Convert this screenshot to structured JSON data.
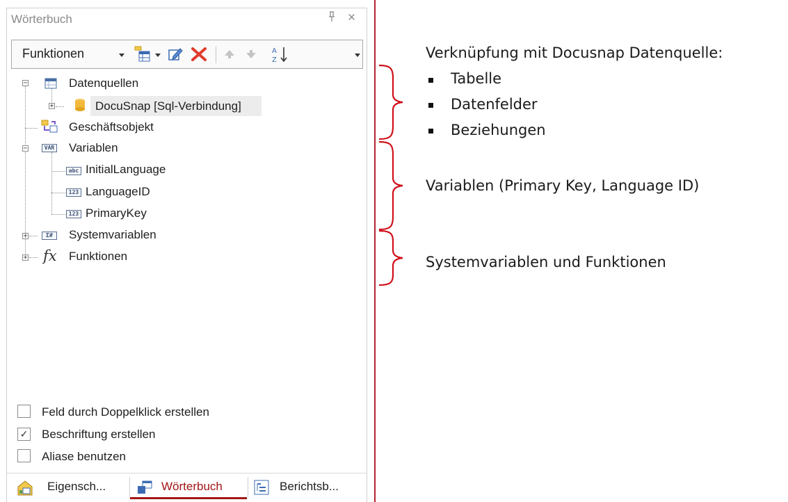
{
  "panel": {
    "title": "Wörterbuch",
    "pin_icon": "pin-icon",
    "close_icon": "close-icon"
  },
  "toolbar": {
    "functions_label": "Funktionen",
    "icons": [
      "new-item-icon",
      "edit-icon",
      "delete-icon",
      "move-up-icon",
      "move-down-icon",
      "sort-icon"
    ]
  },
  "tree": {
    "datasources": "Datenquellen",
    "docusnap": "DocuSnap [Sql-Verbindung]",
    "business_object": "Geschäftsobjekt",
    "variables": "Variablen",
    "var_items": [
      "InitialLanguage",
      "LanguageID",
      "PrimaryKey"
    ],
    "var_tags": [
      "abc",
      "123",
      "123"
    ],
    "variables_tag": "VAR",
    "systemvars": "Systemvariablen",
    "systemvars_tag": "Σ#",
    "functions": "Funktionen",
    "functions_symbol": "fx"
  },
  "options": [
    {
      "label": "Feld durch Doppelklick erstellen",
      "checked": false
    },
    {
      "label": "Beschriftung erstellen",
      "checked": true
    },
    {
      "label": "Aliase benutzen",
      "checked": false
    }
  ],
  "tabs": [
    {
      "label": "Eigensch...",
      "active": false
    },
    {
      "label": "Wörterbuch",
      "active": true
    },
    {
      "label": "Berichtsb...",
      "active": false
    }
  ],
  "annotations": {
    "heading": "Verknüpfung mit Docusnap Datenquelle:",
    "bullets": [
      "Tabelle",
      "Datenfelder",
      "Beziehungen"
    ],
    "variables": "Variablen (Primary Key, Language ID)",
    "systemvars": "Systemvariablen und Funktionen"
  },
  "colors": {
    "accent": "#b5212e",
    "active_tab": "#a31515"
  }
}
